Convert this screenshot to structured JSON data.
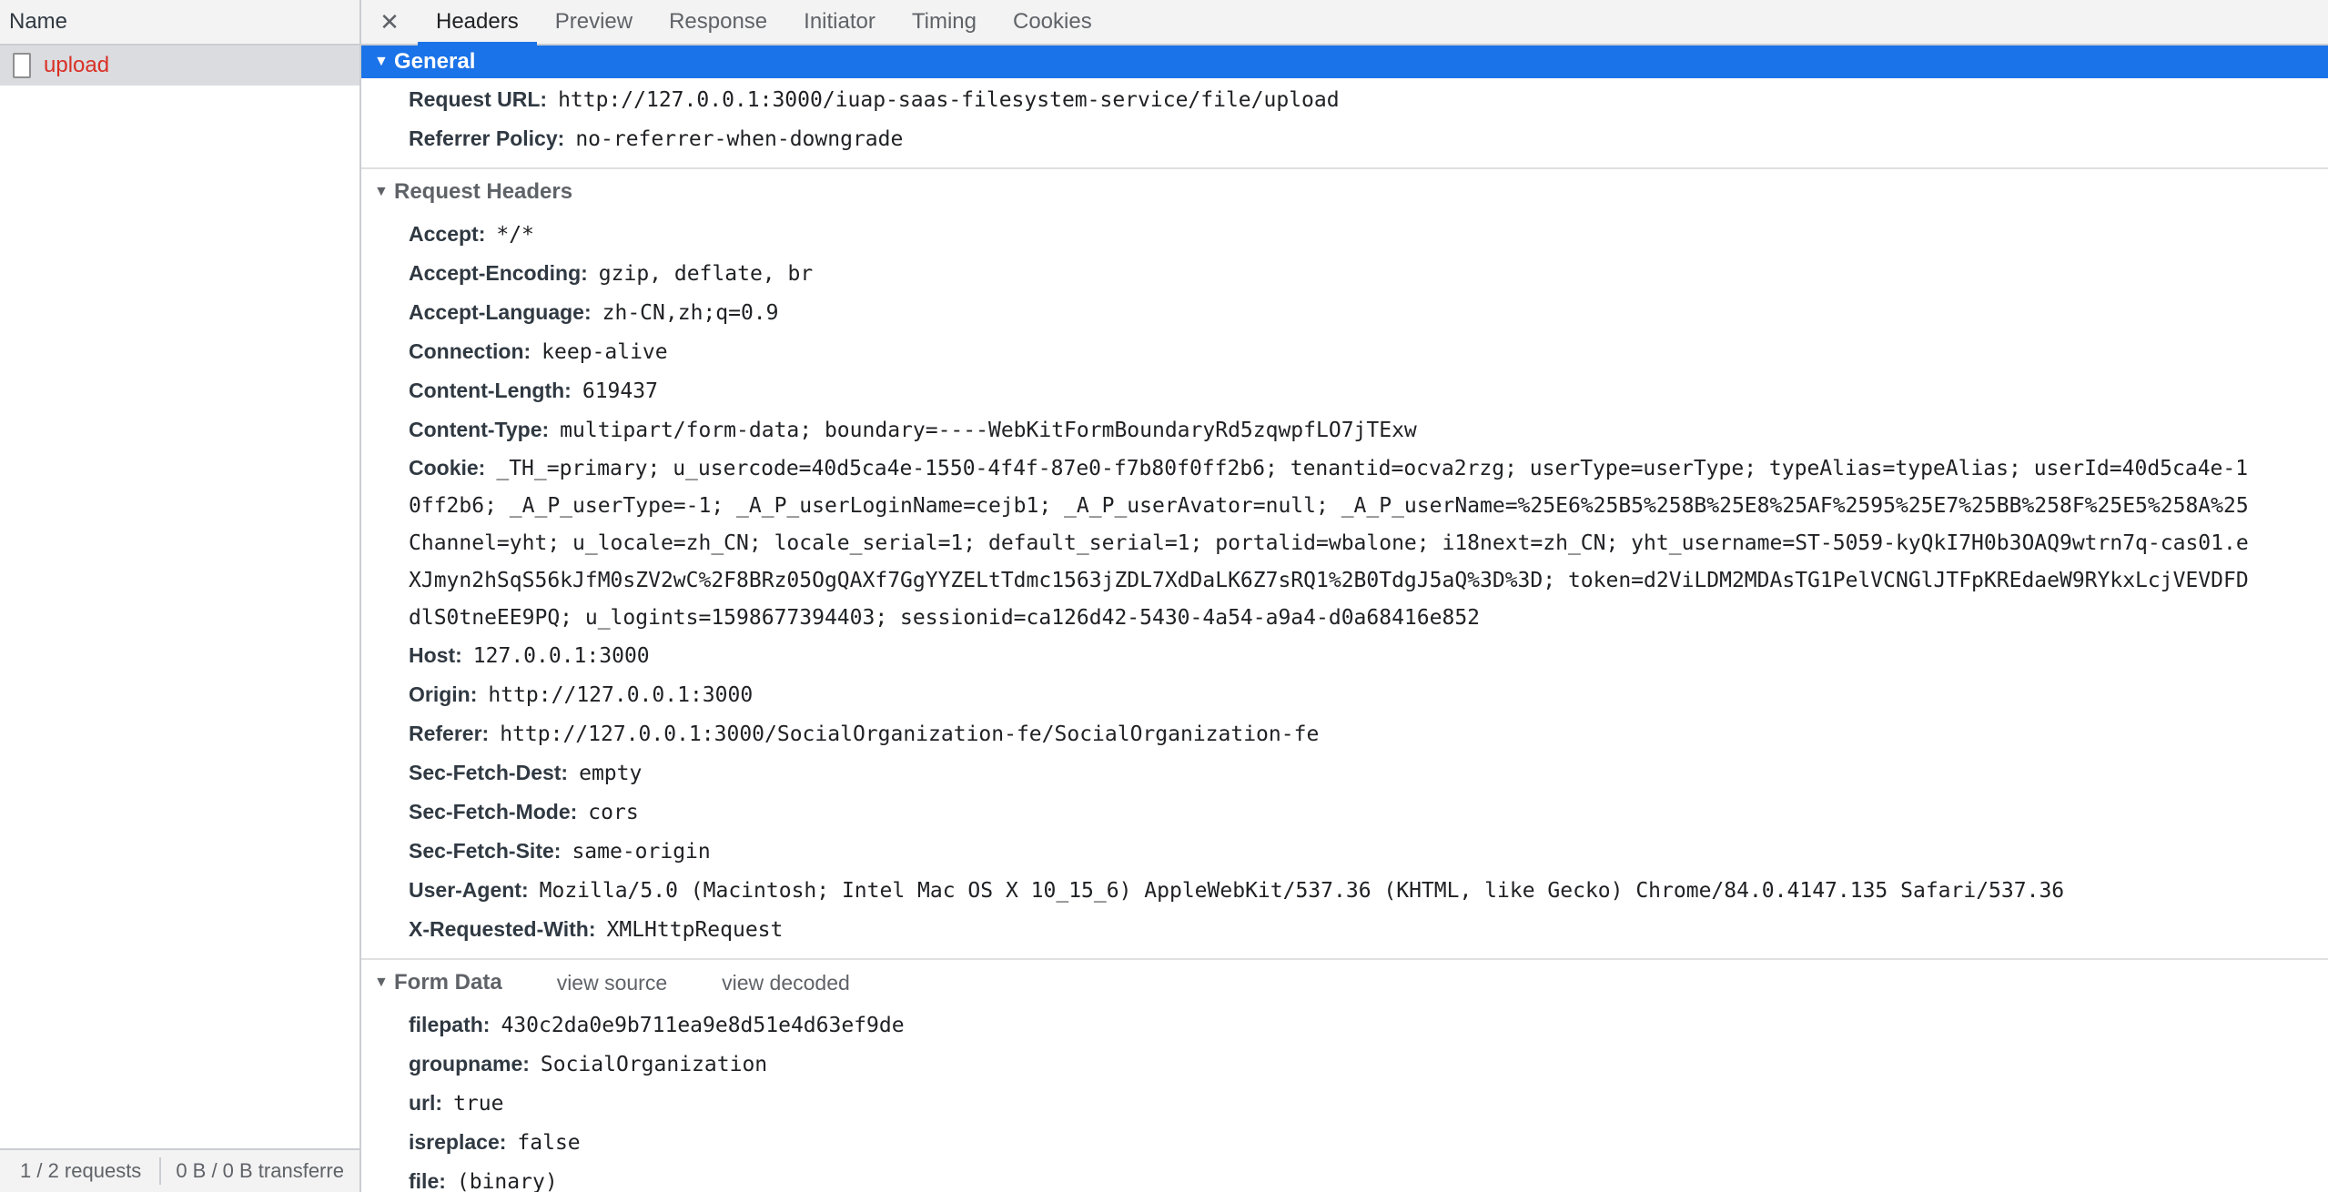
{
  "request_list": {
    "column_header": "Name",
    "requests": [
      {
        "name": "upload"
      }
    ],
    "status": {
      "count": "1 / 2 requests",
      "transfer": "0 B / 0 B transferre"
    }
  },
  "tabs": [
    "Headers",
    "Preview",
    "Response",
    "Initiator",
    "Timing",
    "Cookies"
  ],
  "active_tab": "Headers",
  "general": {
    "title": "General",
    "rows": [
      {
        "key": "Request URL:",
        "value": "http://127.0.0.1:3000/iuap-saas-filesystem-service/file/upload"
      },
      {
        "key": "Referrer Policy:",
        "value": "no-referrer-when-downgrade"
      }
    ]
  },
  "request_headers": {
    "title": "Request Headers",
    "rows_before_cookie": [
      {
        "key": "Accept:",
        "value": "*/*"
      },
      {
        "key": "Accept-Encoding:",
        "value": "gzip, deflate, br"
      },
      {
        "key": "Accept-Language:",
        "value": "zh-CN,zh;q=0.9"
      },
      {
        "key": "Connection:",
        "value": "keep-alive"
      },
      {
        "key": "Content-Length:",
        "value": "619437"
      },
      {
        "key": "Content-Type:",
        "value": "multipart/form-data; boundary=----WebKitFormBoundaryRd5zqwpfLO7jTExw"
      }
    ],
    "cookie": {
      "key": "Cookie:",
      "lines": [
        "_TH_=primary; u_usercode=40d5ca4e-1550-4f4f-87e0-f7b80f0ff2b6; tenantid=ocva2rzg; userType=userType; typeAlias=typeAlias; userId=40d5ca4e-1",
        "0ff2b6; _A_P_userType=-1; _A_P_userLoginName=cejb1; _A_P_userAvator=null; _A_P_userName=%25E6%25B5%258B%25E8%25AF%2595%25E7%25BB%258F%25E5%258A%25",
        "Channel=yht; u_locale=zh_CN; locale_serial=1; default_serial=1; portalid=wbalone; i18next=zh_CN; yht_username=ST-5059-kyQkI7H0b3OAQ9wtrn7q-cas01.e",
        "XJmyn2hSqS56kJfM0sZV2wC%2F8BRz05OgQAXf7GgYYZELtTdmc1563jZDL7XdDaLK6Z7sRQ1%2B0TdgJ5aQ%3D%3D; token=d2ViLDM2MDAsTG1PelVCNGlJTFpKREdaeW9RYkxLcjVEVDFD",
        "dlS0tneEE9PQ; u_logints=1598677394403; sessionid=ca126d42-5430-4a54-a9a4-d0a68416e852"
      ]
    },
    "rows_after_cookie": [
      {
        "key": "Host:",
        "value": "127.0.0.1:3000"
      },
      {
        "key": "Origin:",
        "value": "http://127.0.0.1:3000"
      },
      {
        "key": "Referer:",
        "value": "http://127.0.0.1:3000/SocialOrganization-fe/SocialOrganization-fe"
      },
      {
        "key": "Sec-Fetch-Dest:",
        "value": "empty"
      },
      {
        "key": "Sec-Fetch-Mode:",
        "value": "cors"
      },
      {
        "key": "Sec-Fetch-Site:",
        "value": "same-origin"
      },
      {
        "key": "User-Agent:",
        "value": "Mozilla/5.0 (Macintosh; Intel Mac OS X 10_15_6) AppleWebKit/537.36 (KHTML, like Gecko) Chrome/84.0.4147.135 Safari/537.36"
      },
      {
        "key": "X-Requested-With:",
        "value": "XMLHttpRequest"
      }
    ]
  },
  "form_data": {
    "title": "Form Data",
    "view_source": "view source",
    "view_decoded": "view decoded",
    "rows": [
      {
        "key": "filepath:",
        "value": "430c2da0e9b711ea9e8d51e4d63ef9de"
      },
      {
        "key": "groupname:",
        "value": "SocialOrganization"
      },
      {
        "key": "url:",
        "value": "true"
      },
      {
        "key": "isreplace:",
        "value": "false"
      },
      {
        "key": "file:",
        "value": "(binary)"
      }
    ]
  },
  "colors": {
    "accent": "#1a73e8",
    "request_name": "#d93025"
  }
}
